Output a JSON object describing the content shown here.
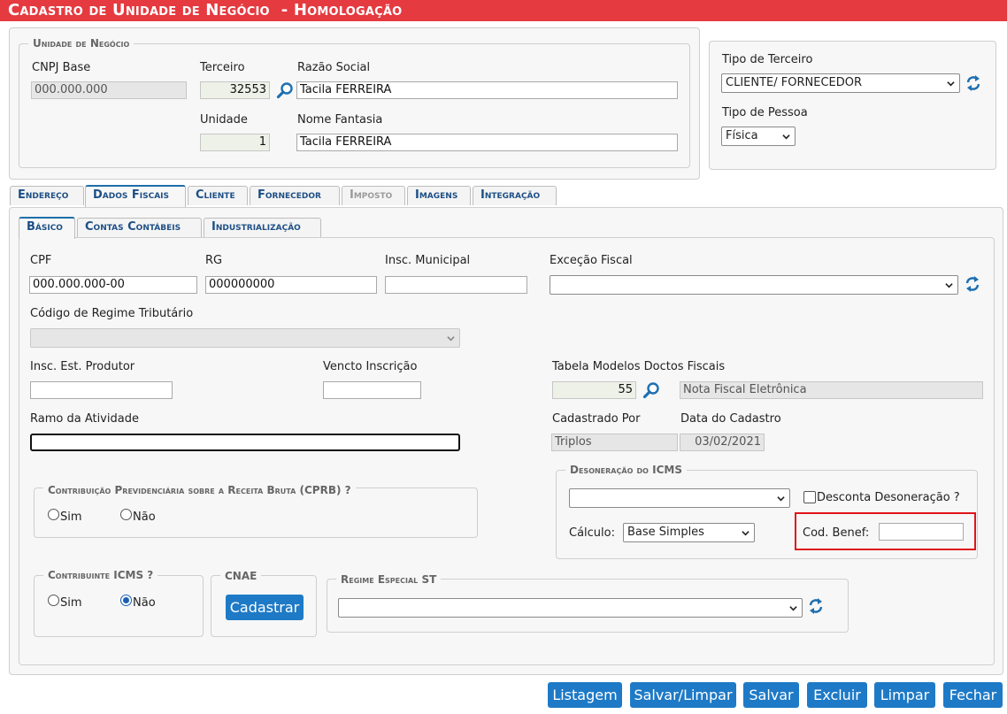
{
  "header": {
    "title": "Cadastro de Unidade de Negócio  - Homologação"
  },
  "unidade": {
    "legend": "Unidade de Negócio",
    "cnpj_label": "CNPJ Base",
    "cnpj_value": "000.000.000",
    "terceiro_label": "Terceiro",
    "terceiro_value": "32553",
    "razao_label": "Razão Social",
    "razao_value": "Tacila FERREIRA",
    "unidade_label": "Unidade",
    "unidade_value": "1",
    "fantasia_label": "Nome Fantasia",
    "fantasia_value": "Tacila FERREIRA"
  },
  "tipo": {
    "terceiro_label": "Tipo de Terceiro",
    "terceiro_value": "CLIENTE/ FORNECEDOR",
    "pessoa_label": "Tipo de Pessoa",
    "pessoa_value": "Física"
  },
  "tabs": [
    "Endereço",
    "Dados Fiscais",
    "Cliente",
    "Fornecedor",
    "Imposto",
    "Imagens",
    "Integração"
  ],
  "subtabs": [
    "Básico",
    "Contas Contábeis",
    "Industrialização"
  ],
  "fiscal": {
    "cpf_label": "CPF",
    "cpf_value": "000.000.000-00",
    "rg_label": "RG",
    "rg_value": "000000000",
    "inscmun_label": "Insc. Municipal",
    "inscmun_value": "",
    "excecao_label": "Exceção Fiscal",
    "excecao_value": "",
    "regime_label": "Código de Regime Tributário",
    "regime_value": "",
    "inscest_label": "Insc. Est. Produtor",
    "inscest_value": "",
    "vencto_label": "Vencto Inscrição",
    "vencto_value": "",
    "tabela_label": "Tabela Modelos Doctos Fiscais",
    "tabela_code": "55",
    "tabela_desc": "Nota Fiscal Eletrônica",
    "ramo_label": "Ramo da Atividade",
    "ramo_value": "",
    "cadastrado_label": "Cadastrado Por",
    "cadastrado_value": "Triplos",
    "data_label": "Data do Cadastro",
    "data_value": "03/02/2021"
  },
  "deson": {
    "legend": "Desoneração do ICMS",
    "select_value": "",
    "desconta_label": "Desconta Desoneração ?",
    "calculo_label": "Cálculo:",
    "calculo_value": "Base Simples",
    "codbenef_label": "Cod. Benef:",
    "codbenef_value": ""
  },
  "cprb": {
    "legend": "Contribuição Previdenciária sobre a Receita Bruta (CPRB) ?",
    "sim": "Sim",
    "nao": "Não",
    "selected": ""
  },
  "icms": {
    "legend": "Contribuinte ICMS ?",
    "sim": "Sim",
    "nao": "Não",
    "selected": "Não"
  },
  "cnae": {
    "legend": "CNAE",
    "button": "Cadastrar"
  },
  "regime_st": {
    "legend": "Regime Especial ST",
    "value": ""
  },
  "actions": [
    "Listagem",
    "Salvar/Limpar",
    "Salvar",
    "Excluir",
    "Limpar",
    "Fechar"
  ],
  "colors": {
    "title_bar": "#e53a40",
    "button": "#1e7ac6",
    "highlight": "#e0141b",
    "tab_text": "#1d4f86"
  }
}
